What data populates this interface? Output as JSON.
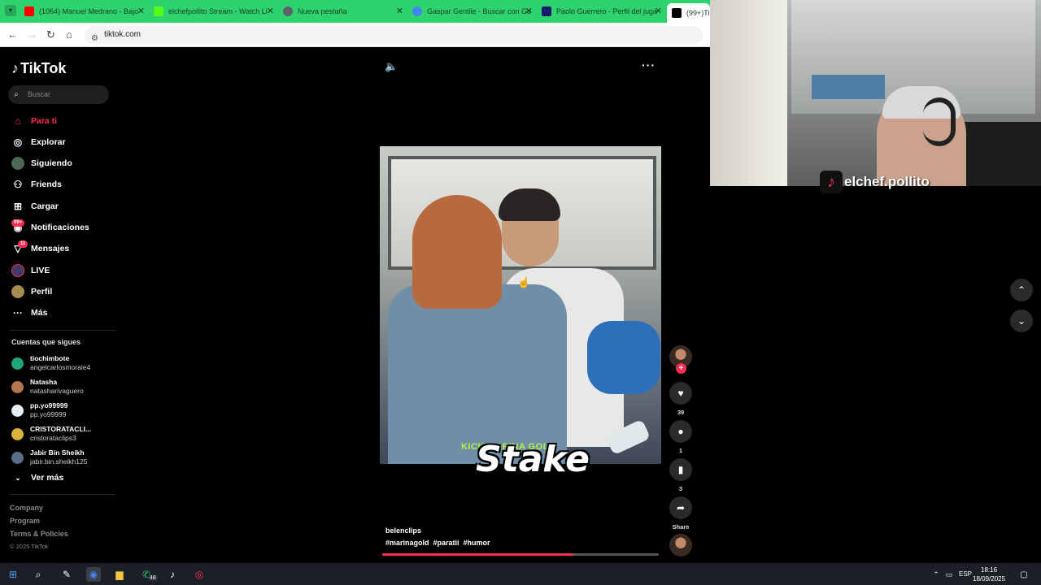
{
  "browser": {
    "tabs": [
      {
        "title": "(1064) Manuel Medrano - Bajo",
        "color": "#ff0000"
      },
      {
        "title": "elchefpollito Stream - Watch Li",
        "color": "#53fc18"
      },
      {
        "title": "Nueva pestaña",
        "color": "#5f6368"
      },
      {
        "title": "Gaspar Gentile - Buscar con Go",
        "color": "#4285f4"
      },
      {
        "title": "Paolo Guerrero - Perfil del juga",
        "color": "#1a1a6e"
      },
      {
        "title": "(99+)TikT",
        "color": "#000000"
      }
    ],
    "url": "tiktok.com"
  },
  "sidebar": {
    "logo": "TikTok",
    "search_placeholder": "Buscar",
    "nav": [
      {
        "label": "Para ti",
        "icon": "home-icon"
      },
      {
        "label": "Explorar",
        "icon": "compass-icon"
      },
      {
        "label": "Siguiendo",
        "icon": "following-icon"
      },
      {
        "label": "Friends",
        "icon": "friends-icon"
      },
      {
        "label": "Cargar",
        "icon": "upload-icon"
      },
      {
        "label": "Notificaciones",
        "icon": "bell-icon",
        "badge": "99+"
      },
      {
        "label": "Mensajes",
        "icon": "send-icon",
        "badge": "11"
      },
      {
        "label": "LIVE",
        "icon": "live-icon"
      },
      {
        "label": "Perfil",
        "icon": "profile-icon"
      },
      {
        "label": "Más",
        "icon": "more-icon"
      }
    ],
    "following_title": "Cuentas que sigues",
    "accounts": [
      {
        "name": "tiochimbote",
        "handle": "angelcarlosmorale4",
        "color": "#1fa67a"
      },
      {
        "name": "Natasha",
        "handle": "natasharivaguero",
        "color": "#b5764f"
      },
      {
        "name": "pp.yo99999",
        "handle": "pp.yo99999",
        "color": "#e7eef5"
      },
      {
        "name": "CRISTORATACLI...",
        "handle": "cristorataclips3",
        "color": "#d9b13b"
      },
      {
        "name": "Jabir Bin Sheikh",
        "handle": "jabir.bin.sheikh125",
        "color": "#5a6e8c"
      }
    ],
    "see_more": "Ver más",
    "footer": [
      "Company",
      "Program",
      "Terms & Policies"
    ],
    "copyright": "© 2025 TikTok"
  },
  "video": {
    "overlay_text": "KICK MARINA GOLD",
    "sponsor": "Stake",
    "author": "belenclips",
    "tags": [
      "#marinagold",
      "#paratii",
      "#humor"
    ],
    "progress": 0.69
  },
  "actions": {
    "likes": "39",
    "comments": "1",
    "saves": "3",
    "share_label": "Share"
  },
  "webcam": {
    "streamer": "elchef.pollito"
  },
  "taskbar": {
    "whatsapp_badge": "48",
    "lang": "ESP",
    "time": "18:16",
    "date": "18/09/2025"
  }
}
